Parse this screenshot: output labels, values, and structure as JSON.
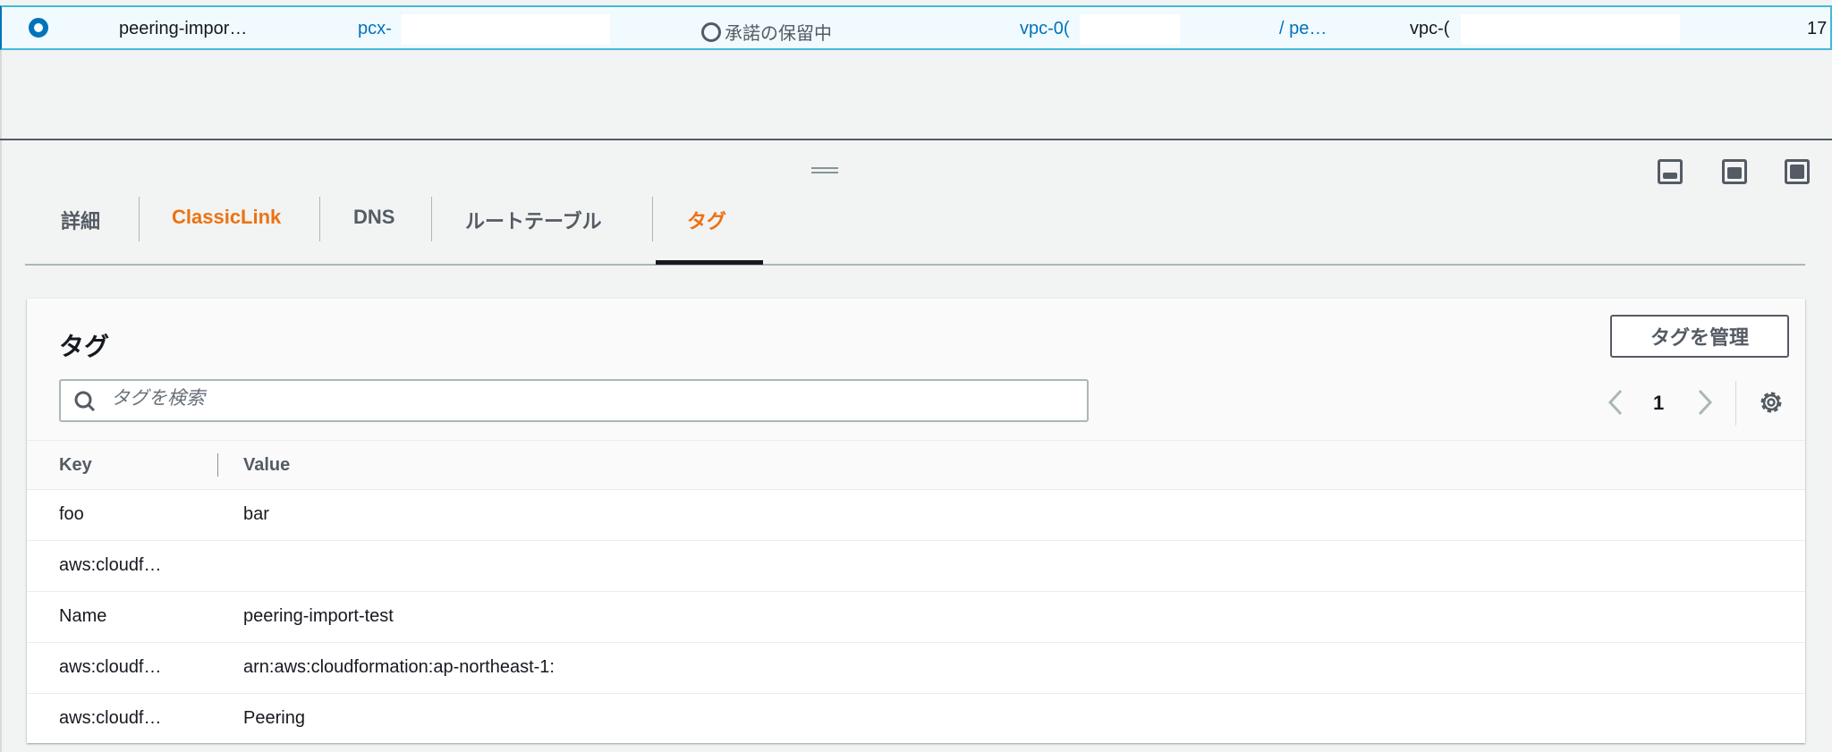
{
  "selected_row": {
    "name": "peering-impor…",
    "id": "pcx-",
    "status": "承諾の保留中",
    "requester_vpc": "vpc-0(",
    "requester_suffix": "/ pe…",
    "accepter_vpc": "vpc-(",
    "trailing": "17"
  },
  "tabs": [
    {
      "label": "詳細"
    },
    {
      "label": "ClassicLink"
    },
    {
      "label": "DNS"
    },
    {
      "label": "ルートテーブル"
    },
    {
      "label": "タグ"
    }
  ],
  "tags_panel": {
    "title": "タグ",
    "manage_button": "タグを管理",
    "search_placeholder": "タグを検索",
    "page": "1",
    "columns": [
      "Key",
      "Value"
    ],
    "rows": [
      {
        "key": "foo",
        "value": "bar"
      },
      {
        "key": "aws:cloudf…",
        "value": ""
      },
      {
        "key": "Name",
        "value": "peering-import-test"
      },
      {
        "key": "aws:cloudf…",
        "value": "arn:aws:cloudformation:ap-northeast-1:"
      },
      {
        "key": "aws:cloudf…",
        "value": "Peering"
      }
    ]
  },
  "colors": {
    "accent": "#ec7211",
    "link": "#0073bb",
    "selected_bg": "#f1faff"
  }
}
